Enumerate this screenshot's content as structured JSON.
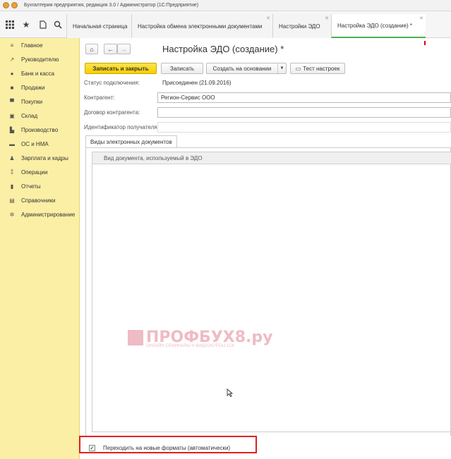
{
  "window": {
    "title": "Бухгалтерия предприятия, редакция 3.0 / Администратор  (1С:Предприятие)"
  },
  "tabs": [
    {
      "label": "Начальная страница"
    },
    {
      "label": "Настройка обмена электронными документами"
    },
    {
      "label": "Настройки ЭДО"
    },
    {
      "label": "Настройка ЭДО (создание) *"
    }
  ],
  "sidebar": {
    "items": [
      {
        "label": "Главное",
        "icon": "menu-icon"
      },
      {
        "label": "Руководителю",
        "icon": "trend-icon"
      },
      {
        "label": "Банк и касса",
        "icon": "coins-icon"
      },
      {
        "label": "Продажи",
        "icon": "bag-icon"
      },
      {
        "label": "Покупки",
        "icon": "cart-icon"
      },
      {
        "label": "Склад",
        "icon": "warehouse-icon"
      },
      {
        "label": "Производство",
        "icon": "factory-icon"
      },
      {
        "label": "ОС и НМА",
        "icon": "car-icon"
      },
      {
        "label": "Зарплата и кадры",
        "icon": "person-icon"
      },
      {
        "label": "Операции",
        "icon": "operations-icon"
      },
      {
        "label": "Отчеты",
        "icon": "chart-icon"
      },
      {
        "label": "Справочники",
        "icon": "book-icon"
      },
      {
        "label": "Администрирование",
        "icon": "gear-icon"
      }
    ]
  },
  "form": {
    "title": "Настройка ЭДО (создание) *",
    "buttons": {
      "save_close": "Записать и закрыть",
      "save": "Записать",
      "create_based": "Создать на основании",
      "test": "Тест настроек"
    },
    "status_label": "Статус подключения:",
    "status_value": "Присоединен (21.09.2016)",
    "counterparty_label": "Контрагент:",
    "counterparty_value": "Регион-Сервис  ООО",
    "contract_label": "Договор контрагента:",
    "contract_value": "",
    "recipient_id_label": "Идентификатор получателя:",
    "recipient_id_value": "",
    "doc_types_tab": "Виды электронных документов",
    "table_header": "Вид документа, используемый в ЭДО",
    "checkbox_label": "Переходить на новые форматы (автоматически)",
    "checkbox_checked": true
  },
  "watermark": {
    "text": "ПРОФБУХ8.ру",
    "sub": "ОНЛАЙН СЕМИНАРЫ И ВИДЕОКУРСЫ 1С8"
  }
}
